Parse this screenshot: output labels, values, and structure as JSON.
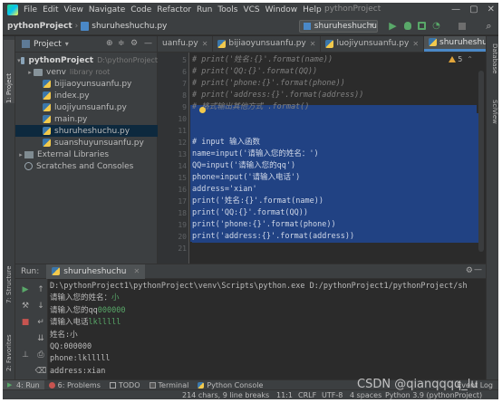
{
  "menu": {
    "items": [
      "File",
      "Edit",
      "View",
      "Navigate",
      "Code",
      "Refactor",
      "Run",
      "Tools",
      "VCS",
      "Window",
      "Help"
    ],
    "window_title": "pythonProject"
  },
  "navbar": {
    "project": "pythonProject",
    "file": "shuruheshuchu.py",
    "run_config": "shuruheshuchu"
  },
  "left_stripe": {
    "project": "1: Project",
    "structure": "7: Structure",
    "favorites": "2: Favorites"
  },
  "right_stripe": {
    "database": "Database",
    "sciview": "SciView"
  },
  "project_panel": {
    "title": "Project",
    "tree": [
      {
        "label": "pythonProject",
        "hint": "D:\\pythonProject",
        "kind": "root-folder"
      },
      {
        "label": "venv",
        "hint": "library root",
        "kind": "folder"
      },
      {
        "label": "bijiaoyunsuanfu.py",
        "hint": "",
        "kind": "py"
      },
      {
        "label": "index.py",
        "hint": "",
        "kind": "py"
      },
      {
        "label": "luojiyunsuanfu.py",
        "hint": "",
        "kind": "py"
      },
      {
        "label": "main.py",
        "hint": "",
        "kind": "py"
      },
      {
        "label": "shuruheshuchu.py",
        "hint": "",
        "kind": "py",
        "selected": true
      },
      {
        "label": "suanshuyunsuanfu.py",
        "hint": "",
        "kind": "py"
      },
      {
        "label": "External Libraries",
        "hint": "",
        "kind": "lib"
      },
      {
        "label": "Scratches and Consoles",
        "hint": "",
        "kind": "scratch"
      }
    ]
  },
  "tabs": [
    {
      "label": "uanfu.py",
      "active": false
    },
    {
      "label": "bijiaoyunsuanfu.py",
      "active": false
    },
    {
      "label": "luojiyunsuanfu.py",
      "active": false
    },
    {
      "label": "shuruheshuchu.py",
      "active": true
    }
  ],
  "editor": {
    "warning_count": "5",
    "lines": [
      {
        "n": "5",
        "text": "# print('姓名:{}'.format(name))",
        "style": "comment"
      },
      {
        "n": "6",
        "text": "# print('QQ:{}'.format(QQ))",
        "style": "comment"
      },
      {
        "n": "7",
        "text": "# print('phone:{}'.format(phone))",
        "style": "comment"
      },
      {
        "n": "8",
        "text": "# print('address:{}'.format(address))",
        "style": "comment"
      },
      {
        "n": "9",
        "text": "# 格式输出其他方式 .format()",
        "style": "comment"
      },
      {
        "n": "10",
        "text": "",
        "style": "sel"
      },
      {
        "n": "11",
        "text": "",
        "style": "sel"
      },
      {
        "n": "12",
        "text": "# input 输入函数",
        "style": "sel"
      },
      {
        "n": "13",
        "text": "name=input('请输入您的姓名：')",
        "style": "sel"
      },
      {
        "n": "14",
        "text": "QQ=input('请输入您的qq')",
        "style": "sel"
      },
      {
        "n": "15",
        "text": "phone=input('请输入电话')",
        "style": "sel"
      },
      {
        "n": "16",
        "text": "address='xian'",
        "style": "sel"
      },
      {
        "n": "17",
        "text": "print('姓名:{}'.format(name))",
        "style": "sel"
      },
      {
        "n": "18",
        "text": "print('QQ:{}'.format(QQ))",
        "style": "sel"
      },
      {
        "n": "19",
        "text": "print('phone:{}'.format(phone))",
        "style": "sel"
      },
      {
        "n": "20",
        "text": "print('address:{}'.format(address))",
        "style": "sel"
      },
      {
        "n": "21",
        "text": "",
        "style": "plain"
      }
    ]
  },
  "run_panel": {
    "label": "Run:",
    "tab": "shuruheshuchu",
    "console": [
      {
        "text": "D:\\pythonProject1\\pythonProject\\venv\\Scripts\\python.exe D:/pythonProject1/pythonProject/sh",
        "input": ""
      },
      {
        "text": "请输入您的姓名：",
        "input": "小"
      },
      {
        "text": "请输入您的qq",
        "input": "000000"
      },
      {
        "text": "请输入电话",
        "input": "lklllll"
      },
      {
        "text": "姓名:小",
        "input": ""
      },
      {
        "text": "QQ:000000",
        "input": ""
      },
      {
        "text": "phone:lklllll",
        "input": ""
      },
      {
        "text": "address:xian",
        "input": ""
      }
    ]
  },
  "bottom_tabs": [
    {
      "label": "4: Run",
      "active": true
    },
    {
      "label": "6: Problems",
      "active": false
    },
    {
      "label": "TODO",
      "active": false
    },
    {
      "label": "Terminal",
      "active": false
    },
    {
      "label": "Python Console",
      "active": false
    }
  ],
  "event_log": "Event Log",
  "status": {
    "chars": "214 chars, 9 line breaks",
    "pos": "11:1",
    "crlf": "CRLF",
    "encoding": "UTF-8",
    "indent": "4 spaces",
    "interpreter": "Python 3.9 (pythonProject)"
  },
  "watermark": "CSDN @qianqqqq_lu",
  "colors": {
    "selection": "#214283",
    "run_green": "#59a869",
    "accent": "#4a88c7",
    "warning": "#e2a53a"
  }
}
